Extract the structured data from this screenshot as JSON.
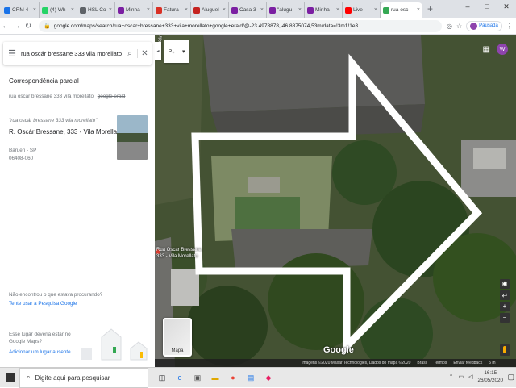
{
  "browser": {
    "tabs": [
      {
        "label": "CRM 4",
        "color": "#1a73e8"
      },
      {
        "label": "(4) Wh",
        "color": "#25d366"
      },
      {
        "label": "HSL Co",
        "color": "#5f6368"
      },
      {
        "label": "Minha",
        "color": "#7b1fa2"
      },
      {
        "label": "Fatura",
        "color": "#d93025"
      },
      {
        "label": "Aluguel",
        "color": "#c5221f"
      },
      {
        "label": "Casa 3",
        "color": "#7b1fa2"
      },
      {
        "label": "\"alugu",
        "color": "#7b1fa2"
      },
      {
        "label": "Minha",
        "color": "#7b1fa2"
      },
      {
        "label": "Live",
        "color": "#ff0000"
      },
      {
        "label": "rua osc",
        "color": "#34a853"
      }
    ],
    "new_tab": "+",
    "window_controls": [
      "–",
      "□",
      "✕"
    ],
    "url": "google.com/maps/search/rua+oscar+bressane+333+vila+morellato+google+erald/@-23.4978878,-46.8875074,53m/data=!3m1!1e3",
    "profile_status": "Pausada"
  },
  "sidepanel": {
    "search_value": "rua oscár bressane 333 vila morellato",
    "partial_match_title": "Correspondência parcial",
    "partial_query": "rua oscár bressane 333 vila morellato",
    "partial_query_struck": "google erald",
    "result": {
      "query": "\"rua oscár bressane 333 vila morellato\"",
      "name": "R. Oscár Bressane, 333 - Vila Morellato",
      "city": "Barueri - SP",
      "cep": "06408-060"
    },
    "not_found": "Não encontrou o que estava procurando?",
    "try_link": "Tente usar a Pesquisa Google",
    "missing_place": "Esse lugar deveria estar no Google Maps?",
    "add_place": "Adicionar um lugar ausente"
  },
  "map": {
    "street_label_rotated": "Rua Oscár Bressane",
    "pin_label_line1": "Rua Oscár Bressane,",
    "pin_label_line2": "333 - Vila Morellato",
    "layers_label": "Mapa",
    "google_logo": "Google",
    "footer": [
      "Imagens ©2020 Maxar Technologies, Dados do mapa ©2020",
      "Brasil",
      "Termos",
      "Enviar feedback",
      "5 m"
    ],
    "profile_initial": "W"
  },
  "taskbar": {
    "search_placeholder": "Digite aqui para pesquisar",
    "time": "16:15",
    "date": "26/05/2020"
  }
}
